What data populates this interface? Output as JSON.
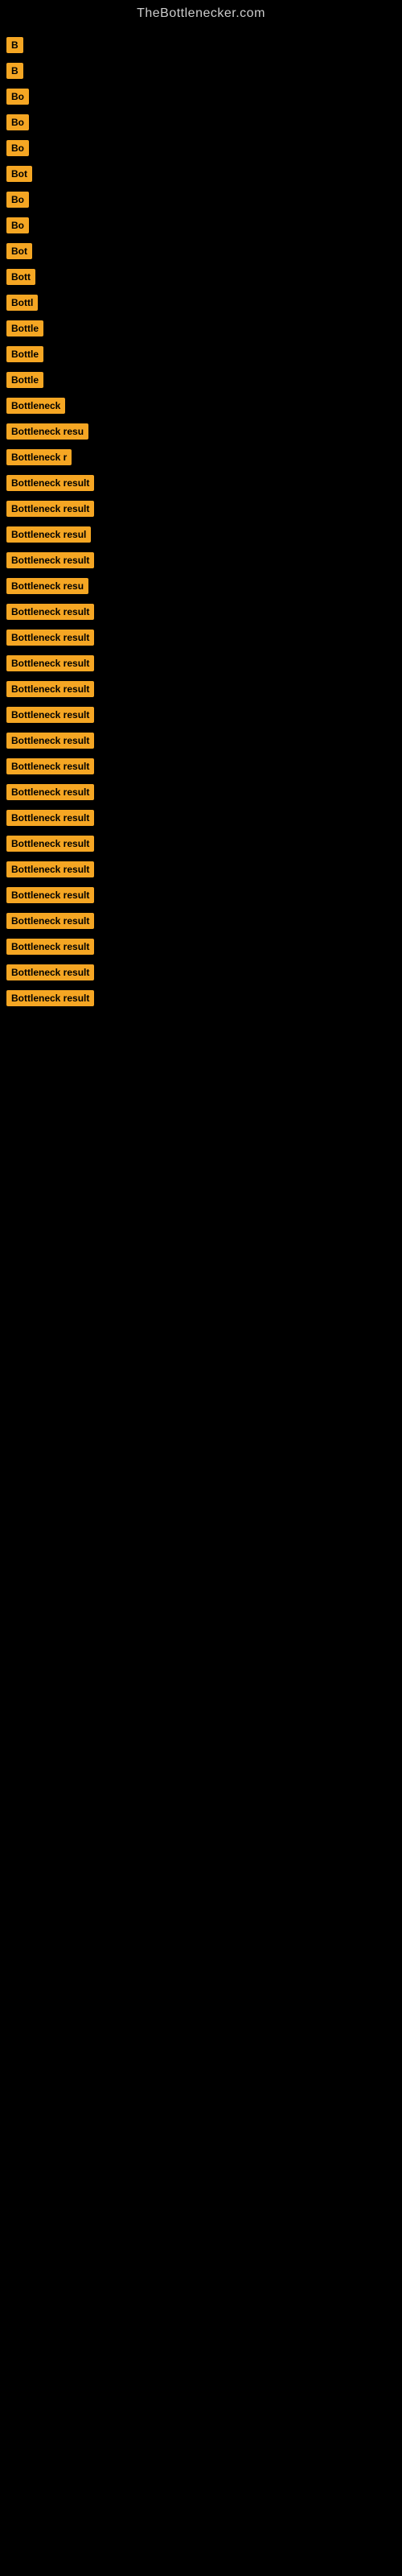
{
  "site": {
    "title": "TheBottlenecker.com"
  },
  "badges": [
    {
      "label": "B"
    },
    {
      "label": "B"
    },
    {
      "label": "Bo"
    },
    {
      "label": "Bo"
    },
    {
      "label": "Bo"
    },
    {
      "label": "Bot"
    },
    {
      "label": "Bo"
    },
    {
      "label": "Bo"
    },
    {
      "label": "Bot"
    },
    {
      "label": "Bott"
    },
    {
      "label": "Bottl"
    },
    {
      "label": "Bottle"
    },
    {
      "label": "Bottle"
    },
    {
      "label": "Bottle"
    },
    {
      "label": "Bottleneck"
    },
    {
      "label": "Bottleneck resu"
    },
    {
      "label": "Bottleneck r"
    },
    {
      "label": "Bottleneck result"
    },
    {
      "label": "Bottleneck result"
    },
    {
      "label": "Bottleneck resul"
    },
    {
      "label": "Bottleneck result"
    },
    {
      "label": "Bottleneck resu"
    },
    {
      "label": "Bottleneck result"
    },
    {
      "label": "Bottleneck result"
    },
    {
      "label": "Bottleneck result"
    },
    {
      "label": "Bottleneck result"
    },
    {
      "label": "Bottleneck result"
    },
    {
      "label": "Bottleneck result"
    },
    {
      "label": "Bottleneck result"
    },
    {
      "label": "Bottleneck result"
    },
    {
      "label": "Bottleneck result"
    },
    {
      "label": "Bottleneck result"
    },
    {
      "label": "Bottleneck result"
    },
    {
      "label": "Bottleneck result"
    },
    {
      "label": "Bottleneck result"
    },
    {
      "label": "Bottleneck result"
    },
    {
      "label": "Bottleneck result"
    },
    {
      "label": "Bottleneck result"
    }
  ]
}
